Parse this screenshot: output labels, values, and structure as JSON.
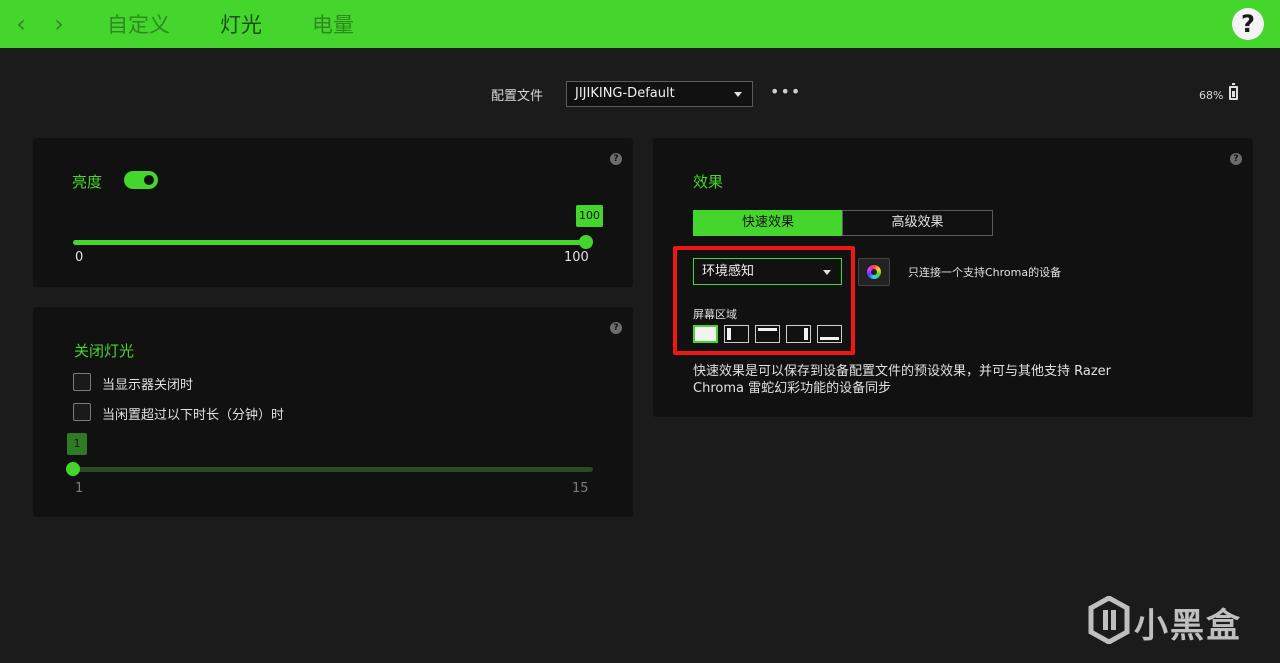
{
  "nav": {
    "tabs": [
      {
        "label": "自定义",
        "active": false
      },
      {
        "label": "灯光",
        "active": true
      },
      {
        "label": "电量",
        "active": false
      }
    ],
    "help_label": "?"
  },
  "header": {
    "profile_label": "配置文件",
    "profile_value": "JIJIKING-Default",
    "more_label": "•••",
    "battery_text": "68%"
  },
  "brightness": {
    "title": "亮度",
    "enabled": true,
    "value": "100",
    "min_label": "0",
    "max_label": "100",
    "fraction": 1.0
  },
  "lights_off": {
    "title": "关闭灯光",
    "options": [
      {
        "label": "当显示器关闭时",
        "checked": false
      },
      {
        "label": "当闲置超过以下时长（分钟）时",
        "checked": false
      }
    ],
    "value": "1",
    "min_label": "1",
    "max_label": "15",
    "fraction": 0.0
  },
  "effects": {
    "title": "效果",
    "tabs": [
      {
        "label": "快速效果",
        "active": true
      },
      {
        "label": "高级效果",
        "active": false
      }
    ],
    "selected_effect": "环境感知",
    "chroma_note": "只连接一个支持Chroma的设备",
    "zone_label": "屏幕区域",
    "zones": [
      "full",
      "left",
      "top",
      "right",
      "bottom"
    ],
    "selected_zone": "full",
    "description": "快速效果是可以保存到设备配置文件的预设效果，并可与其他支持 Razer Chroma 雷蛇幻彩功能的设备同步"
  },
  "watermark": {
    "text": "小黑盒"
  },
  "colors": {
    "accent": "#44d62c",
    "highlight_box": "#f01616",
    "panel": "#111111",
    "background": "#1b1b1b"
  }
}
